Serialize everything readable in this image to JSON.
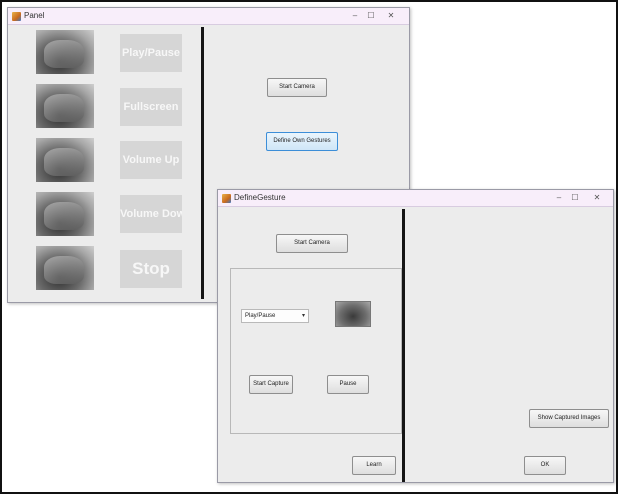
{
  "panel_window": {
    "title": "Panel",
    "caption_buttons": {
      "minimize": "–",
      "maximize": "☐",
      "close": "✕"
    },
    "gestures": [
      {
        "image_icon": "hand-gesture-image",
        "label": "Play/Pause"
      },
      {
        "image_icon": "hand-gesture-image",
        "label": "Fullscreen"
      },
      {
        "image_icon": "hand-gesture-image",
        "label": "Volume Up"
      },
      {
        "image_icon": "hand-gesture-image",
        "label": "Volume Down"
      },
      {
        "image_icon": "hand-gesture-image",
        "label": "Stop"
      }
    ],
    "start_camera_button": "Start Camera",
    "define_gestures_button": "Define Own Gestures"
  },
  "define_window": {
    "title": "DefineGesture",
    "caption_buttons": {
      "minimize": "–",
      "maximize": "☐",
      "close": "✕"
    },
    "start_camera_button": "Start Camera",
    "gesture_select": {
      "value": "Play/Pause",
      "arrow": "▾"
    },
    "start_capture_button": "Start Capture",
    "pause_button": "Pause",
    "learn_button": "Learn",
    "show_captured_images_button": "Show Captured Images",
    "ok_button": "OK"
  },
  "colors": {
    "titlebar": "#f8eefa",
    "window_bg": "#ececec",
    "gesture_label_bg": "#d6d6d6",
    "focus_border": "#3c8ed8"
  }
}
